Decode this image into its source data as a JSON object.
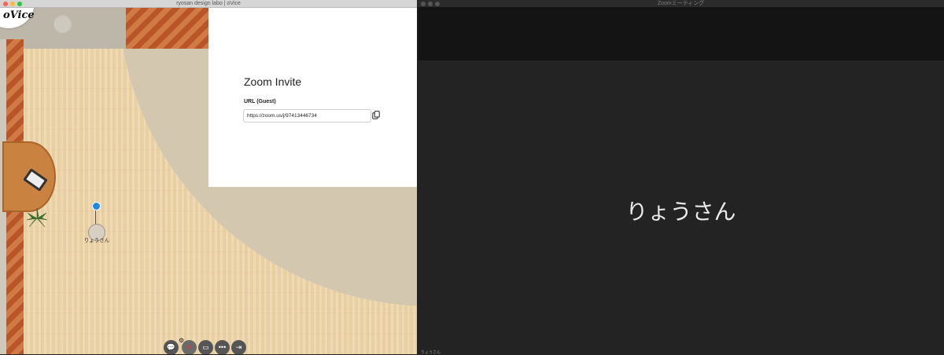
{
  "ovice_window": {
    "title": "ryosan design labo | oVice",
    "logo_text": "oVice",
    "avatar_name": "りょうさん",
    "colors": {
      "avatar_pin": "#1e88e5",
      "wood": "#c98240",
      "floor": "#ecd4a8"
    },
    "toolbar_icons": [
      "chat-icon",
      "gear-icon",
      "mic-off-icon",
      "screen-share-icon",
      "more-icon",
      "exit-icon"
    ]
  },
  "zoom_invite": {
    "title": "Zoom Invite",
    "url_label": "URL (Guest)",
    "url_value": "https://zoom.us/j/97413446734",
    "copy_icon": "copy-icon"
  },
  "zoom_window": {
    "title": "Zoomミーティング",
    "participant_name": "りょうさん",
    "status_text": "りょうさん"
  }
}
